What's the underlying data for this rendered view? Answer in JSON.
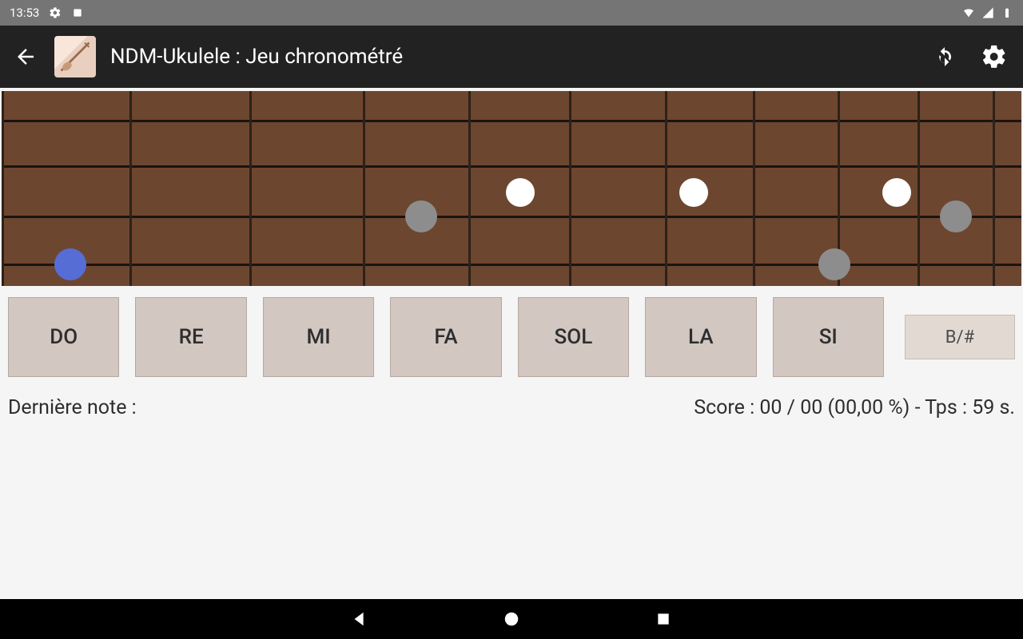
{
  "status_bar": {
    "time": "13:53"
  },
  "app_bar": {
    "title": "NDM-Ukulele : Jeu chronométré"
  },
  "note_buttons": [
    "DO",
    "RE",
    "MI",
    "FA",
    "SOL",
    "LA",
    "SI"
  ],
  "sharp_button": "B/#",
  "footer": {
    "last_note_label": "Dernière note :",
    "score_text": "Score :   00 / 00 (00,00 %)   - Tps :   59   s."
  }
}
